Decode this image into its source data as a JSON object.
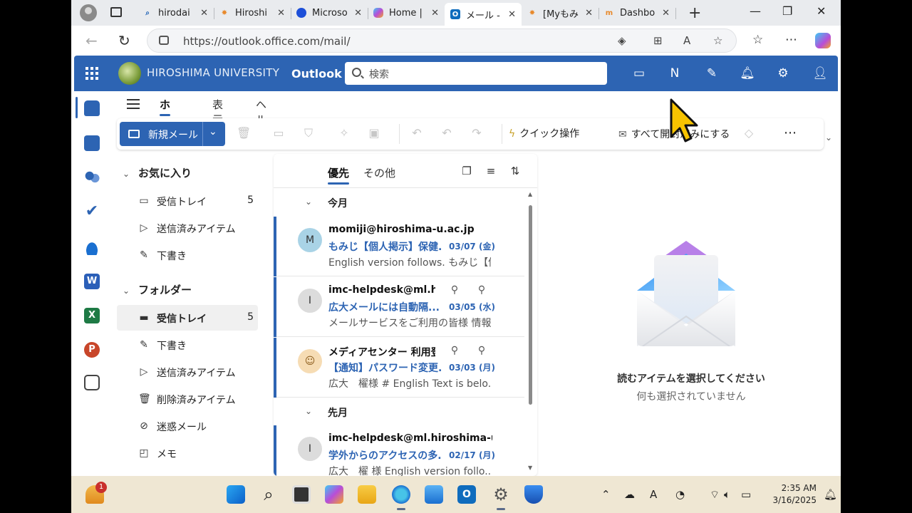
{
  "browser": {
    "tabs": [
      {
        "label": "hirodai",
        "icon": "search-icon",
        "active": false
      },
      {
        "label": "Hiroshi",
        "icon": "momiji-icon",
        "active": false
      },
      {
        "label": "Microso",
        "icon": "edge-icon",
        "active": false
      },
      {
        "label": "Home |",
        "icon": "copilot-icon",
        "active": false
      },
      {
        "label": "メール - ",
        "icon": "outlook-icon",
        "active": true
      },
      {
        "label": "[Myもみ",
        "icon": "momiji-icon",
        "active": false
      },
      {
        "label": "Dashbo",
        "icon": "moodle-icon",
        "active": false
      }
    ],
    "url": "https://outlook.office.com/mail/"
  },
  "outlook": {
    "org_name": "HIROSHIMA UNIVERSITY",
    "app_name": "Outlook",
    "search_placeholder": "検索",
    "ribbon_tabs": [
      "ホーム",
      "表示",
      "ヘルプ"
    ],
    "new_mail_label": "新規メール",
    "quick_steps_label": "クイック操作",
    "mark_all_read_label": "すべて開封済みにする"
  },
  "folders": {
    "favorites_label": "お気に入り",
    "favorites": [
      {
        "label": "受信トレイ",
        "count": "5",
        "icon": "inbox-icon"
      },
      {
        "label": "送信済みアイテム",
        "count": "",
        "icon": "send-icon"
      },
      {
        "label": "下書き",
        "count": "",
        "icon": "draft-icon"
      }
    ],
    "folders_label": "フォルダー",
    "folders": [
      {
        "label": "受信トレイ",
        "count": "5",
        "icon": "inbox-icon",
        "selected": true
      },
      {
        "label": "下書き",
        "count": "",
        "icon": "draft-icon"
      },
      {
        "label": "送信済みアイテム",
        "count": "",
        "icon": "send-icon"
      },
      {
        "label": "削除済みアイテム",
        "count": "",
        "icon": "trash-icon"
      },
      {
        "label": "迷惑メール",
        "count": "",
        "icon": "junk-icon"
      },
      {
        "label": "メモ",
        "count": "",
        "icon": "note-icon"
      }
    ]
  },
  "list": {
    "tab_focused": "優先",
    "tab_other": "その他",
    "group_this_month": "今月",
    "group_last_month": "先月",
    "messages": [
      {
        "avatar": "M",
        "avatar_color": "#a9d3e6",
        "from": "momiji@hiroshima-u.ac.jp",
        "subject": "もみじ【個人掲示】保健...",
        "date": "03/07 (金)",
        "preview": "English version follows. もみじ【個...",
        "icons": []
      },
      {
        "avatar": "I",
        "avatar_color": "#dcdcdc",
        "from": "imc-helpdesk@ml.hi...",
        "subject": "広大メールには自動隔...",
        "date": "03/05 (水)",
        "preview": "メールサービスをご利用の皆様 情報メ...",
        "icons": [
          "ribbon-icon",
          "attachment-icon"
        ]
      },
      {
        "avatar": "person",
        "avatar_color": "#f6dcb4",
        "from": "メディアセンター 利用登...",
        "subject": "【通知】パスワード変更...",
        "date": "03/03 (月)",
        "preview": "広大　櫂様 # English Text is belo...",
        "icons": [
          "ribbon-icon",
          "attachment-icon"
        ]
      },
      {
        "avatar": "I",
        "avatar_color": "#dcdcdc",
        "from": "imc-helpdesk@ml.hiroshima-u....",
        "subject": "学外からのアクセスの多...",
        "date": "02/17 (月)",
        "preview": "広大　櫂 様 English version follo...",
        "icons": []
      }
    ]
  },
  "reading": {
    "title": "読むアイテムを選択してください",
    "subtitle": "何も選択されていません"
  },
  "taskbar": {
    "weather_badge": "1",
    "time": "2:35 AM",
    "date": "3/16/2025"
  }
}
